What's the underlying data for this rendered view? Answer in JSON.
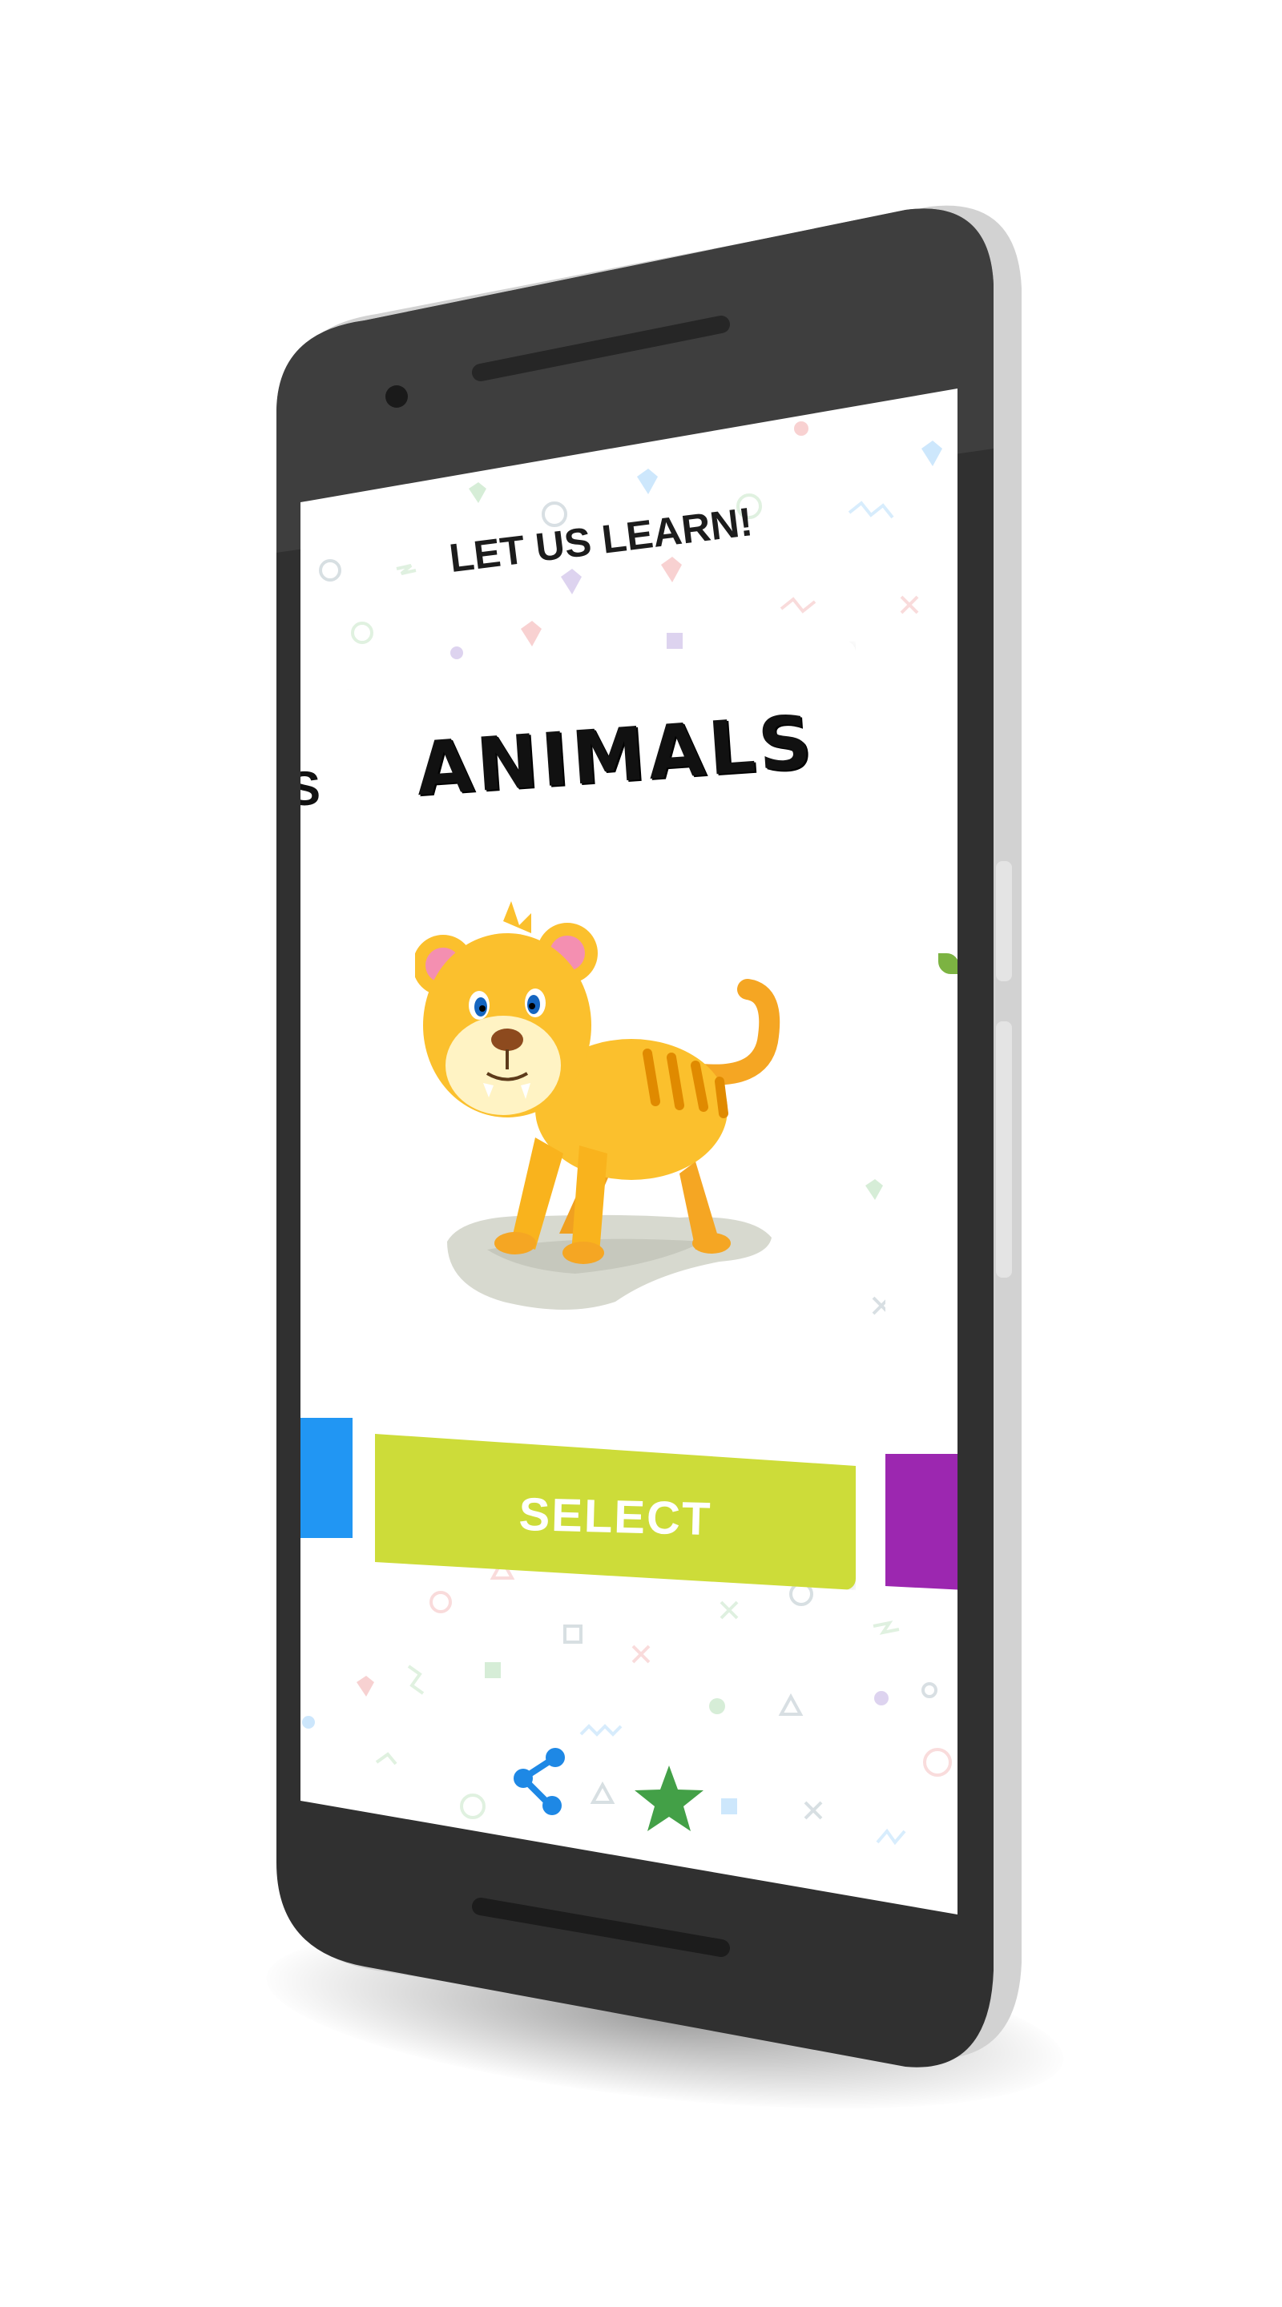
{
  "app": {
    "header_title": "LET US LEARN!"
  },
  "carousel": {
    "current_card": {
      "title": "ANIMALS",
      "image": "tiger-cartoon",
      "button_label": "SELECT",
      "button_color": "#cddc39"
    },
    "left_card": {
      "peek_text": "S",
      "button_color": "#2196f3"
    },
    "right_card": {
      "button_color": "#9c27b0"
    }
  },
  "bottom_actions": {
    "share_icon": "share-icon",
    "share_color": "#1e88e5",
    "star_icon": "star-icon",
    "star_color": "#43a047"
  },
  "device": {
    "frame_color": "#333333",
    "body_color": "#d4d4d4"
  }
}
